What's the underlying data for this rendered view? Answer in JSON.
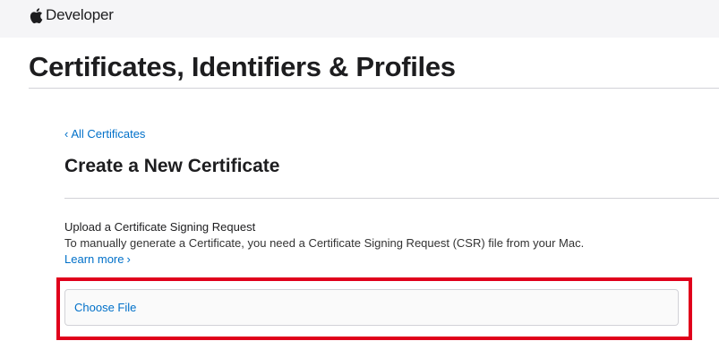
{
  "header": {
    "brand_label": "Developer",
    "logo_icon": "apple-logo-icon"
  },
  "page": {
    "title": "Certificates, Identifiers & Profiles"
  },
  "breadcrumb": {
    "back_chevron": "‹",
    "back_label": "All Certificates"
  },
  "section": {
    "title": "Create a New Certificate"
  },
  "upload": {
    "heading": "Upload a Certificate Signing Request",
    "description": "To manually generate a Certificate, you need a Certificate Signing Request (CSR) file from your Mac.",
    "learn_more_label": "Learn more",
    "learn_more_chevron": "›",
    "choose_file_label": "Choose File"
  },
  "colors": {
    "link": "#0070c9",
    "highlight": "#e0001b",
    "header_bg": "#f5f5f7"
  }
}
